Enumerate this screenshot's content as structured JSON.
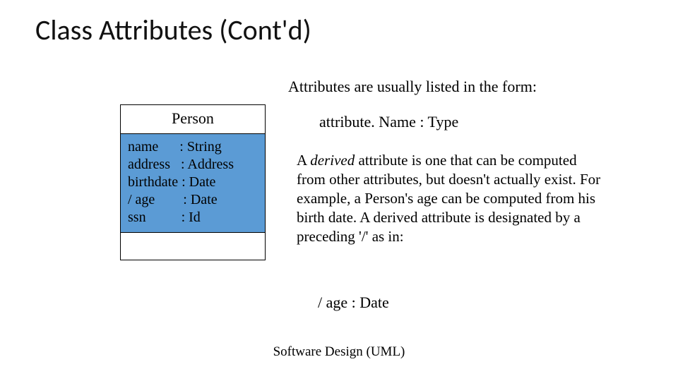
{
  "title": "Class Attributes (Cont'd)",
  "intro": "Attributes are usually listed in the form:",
  "syntax": "attribute. Name : Type",
  "uml": {
    "class_name": "Person",
    "attributes_block": "name      : String\naddress   : Address\nbirthdate : Date\n/ age        : Date\nssn          : Id"
  },
  "body": {
    "pre_italic": "A ",
    "italic": "derived",
    "post_italic": " attribute is one that can be computed from other attributes, but doesn't actually exist. For example, a Person's age can be computed from his birth date. A derived attribute is designated by a preceding '/' as in:"
  },
  "example": "/ age : Date",
  "footer": "Software Design (UML)"
}
